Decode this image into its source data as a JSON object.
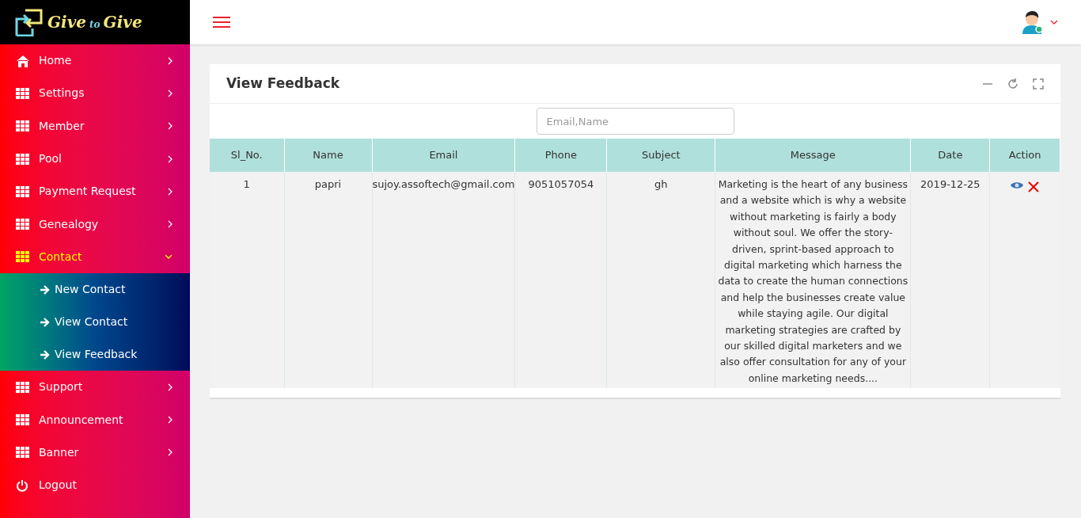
{
  "logo": {
    "text_1": "Give",
    "text_2": "to",
    "text_3": "Give"
  },
  "sidebar": {
    "items": [
      {
        "label": "Home",
        "kind": "home",
        "selected": false,
        "expanded": false
      },
      {
        "label": "Settings",
        "kind": "grid",
        "selected": false,
        "expanded": false
      },
      {
        "label": "Member",
        "kind": "grid",
        "selected": false,
        "expanded": false
      },
      {
        "label": "Pool",
        "kind": "grid",
        "selected": false,
        "expanded": false
      },
      {
        "label": "Payment Request",
        "kind": "grid",
        "selected": false,
        "expanded": false
      },
      {
        "label": "Genealogy",
        "kind": "grid",
        "selected": false,
        "expanded": false
      },
      {
        "label": "Contact",
        "kind": "grid",
        "selected": true,
        "expanded": true,
        "children": [
          {
            "label": "New Contact"
          },
          {
            "label": "View Contact"
          },
          {
            "label": "View Feedback"
          }
        ]
      },
      {
        "label": "Support",
        "kind": "grid",
        "selected": false,
        "expanded": false
      },
      {
        "label": "Announcement",
        "kind": "grid",
        "selected": false,
        "expanded": false
      },
      {
        "label": "Banner",
        "kind": "grid",
        "selected": false,
        "expanded": false
      },
      {
        "label": "Logout",
        "kind": "logout",
        "selected": false
      }
    ]
  },
  "panel": {
    "title": "View Feedback",
    "search": {
      "placeholder": "Email,Name"
    },
    "table": {
      "columns": [
        "Sl_No.",
        "Name",
        "Email",
        "Phone",
        "Subject",
        "Message",
        "Date",
        "Action"
      ],
      "rows": [
        {
          "cells": [
            "1",
            "papri",
            "sujoy.assoftech@gmail.com",
            "9051057054",
            "gh",
            "Marketing is the heart of any business and a website which is why a website without marketing is fairly a body without soul. We offer the story-driven, sprint-based approach to digital marketing which harness the data to create the human connections and help the businesses create value while staying agile. Our digital marketing strategies are crafted by our skilled digital marketers and we also offer consultation for any of your online marketing needs....",
            "2019-12-25"
          ]
        }
      ]
    }
  }
}
